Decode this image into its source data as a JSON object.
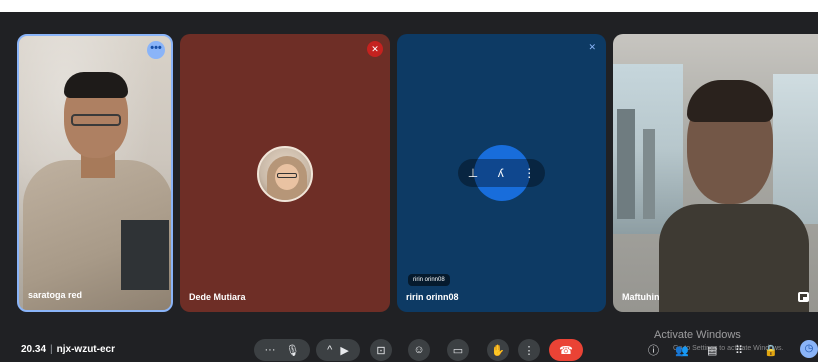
{
  "participants": [
    {
      "name": "saratoga red"
    },
    {
      "name": "Dede Mutiara"
    },
    {
      "name": "ririn orinn08",
      "chip": "ririn orinn08"
    },
    {
      "name": "Maftuhin"
    }
  ],
  "meeting": {
    "time": "20.34",
    "separator": "|",
    "code": "njx-wzut-ecr"
  },
  "watermark": {
    "line1": "Activate Windows",
    "line2": "Go to Settings to activate Windows."
  },
  "icons": {
    "more": "more-options-icon",
    "mic": "microphone-icon",
    "camera": "camera-icon",
    "present": "present-screen-icon",
    "emoji": "emoji-icon",
    "captions": "captions-icon",
    "raise_hand": "raise-hand-icon",
    "end_call": "end-call-icon",
    "info": "info-icon",
    "people": "people-icon",
    "chat": "chat-icon",
    "activities": "activities-icon",
    "host": "host-controls-icon"
  },
  "colors": {
    "accent": "#8ab4f8",
    "end_call": "#ea4335",
    "tile2": "#6e2e26",
    "tile3": "#0d3a64"
  }
}
